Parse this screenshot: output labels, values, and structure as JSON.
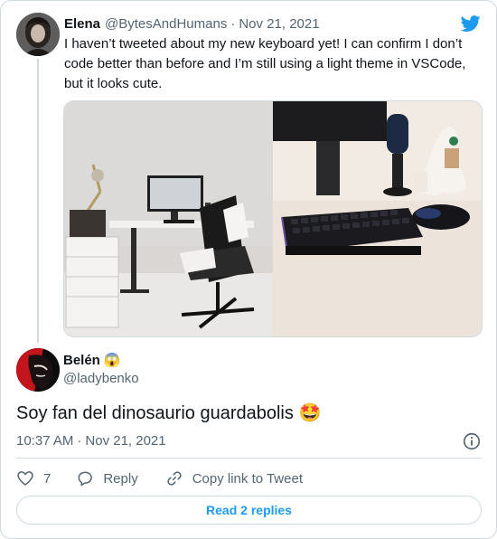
{
  "parent_tweet": {
    "name": "Elena",
    "handle": "@BytesAndHumans",
    "separator": "·",
    "date": "Nov 21, 2021",
    "text": "I haven’t tweeted about my new keyboard yet! I can confirm I don’t code better than before and I’m still using a light theme in VSCode, but it looks cute.",
    "media": [
      {
        "icon": "photo-desk-setup"
      },
      {
        "icon": "photo-keyboard-closeup"
      }
    ]
  },
  "main_tweet": {
    "name": "Belén",
    "name_emoji": "😱",
    "handle": "@ladybenko",
    "text": "Soy fan del dinosaurio guardabolis",
    "text_emoji": "🤩",
    "time": "10:37 AM",
    "separator": "·",
    "date": "Nov 21, 2021"
  },
  "actions": {
    "like_count": "7",
    "reply_label": "Reply",
    "copy_link_label": "Copy link to Tweet",
    "read_replies_label": "Read 2 replies"
  },
  "colors": {
    "accent": "#1d9bf0",
    "text": "#0f1419",
    "secondary": "#536471",
    "border": "#cfd9de"
  },
  "icons": [
    "twitter-bird-icon",
    "info-icon",
    "heart-icon",
    "reply-bubble-icon",
    "link-icon"
  ]
}
